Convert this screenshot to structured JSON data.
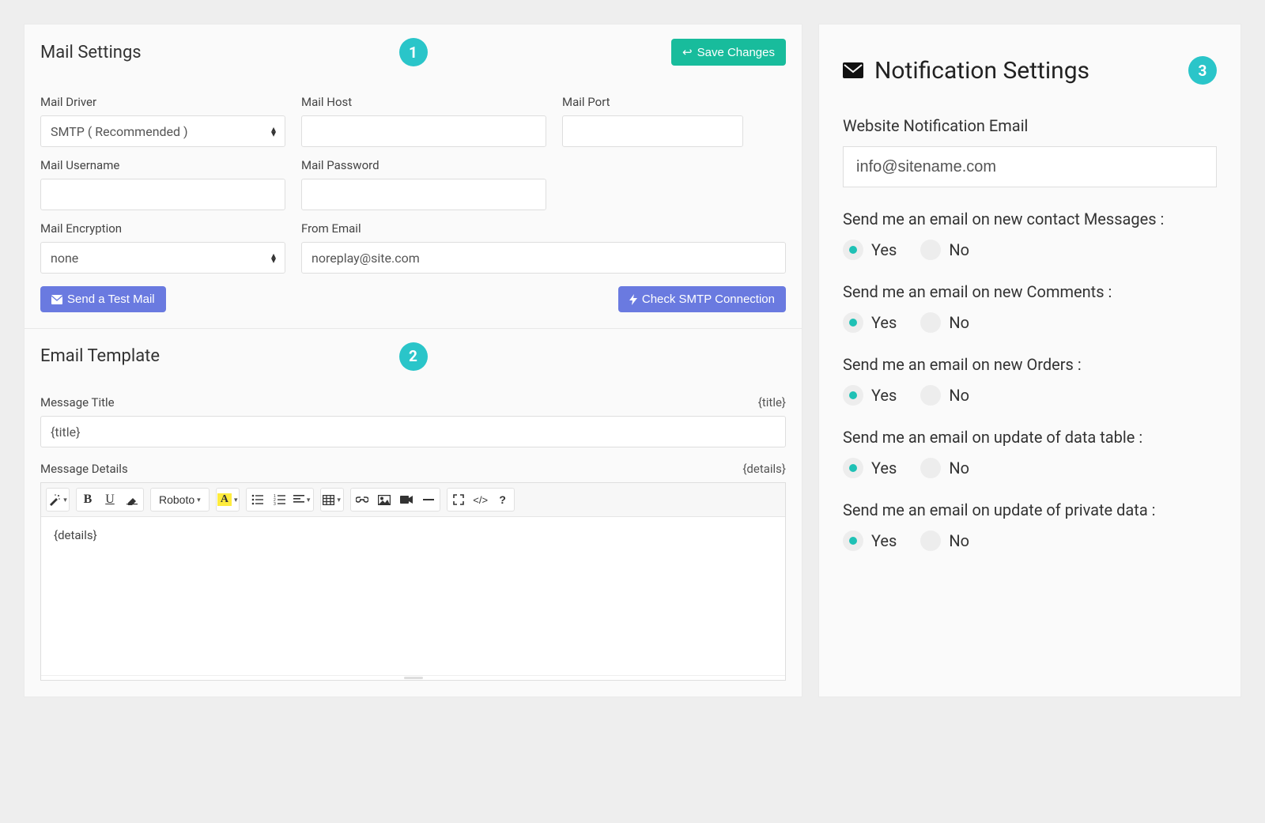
{
  "badges": {
    "one": "1",
    "two": "2",
    "three": "3"
  },
  "mail": {
    "title": "Mail Settings",
    "save_label": "Save Changes",
    "fields": {
      "driver_label": "Mail Driver",
      "driver_value": "SMTP ( Recommended )",
      "host_label": "Mail Host",
      "host_value": "",
      "port_label": "Mail Port",
      "port_value": "",
      "username_label": "Mail Username",
      "username_value": "",
      "password_label": "Mail Password",
      "password_value": "",
      "encryption_label": "Mail Encryption",
      "encryption_value": "none",
      "from_label": "From Email",
      "from_value": "noreplay@site.com"
    },
    "test_mail_label": "Send a Test Mail",
    "check_smtp_label": "Check SMTP Connection"
  },
  "template": {
    "title": "Email Template",
    "msg_title_label": "Message Title",
    "msg_title_hint": "{title}",
    "msg_title_value": "{title}",
    "msg_details_label": "Message Details",
    "msg_details_hint": "{details}",
    "msg_details_value": "{details}",
    "font_name": "Roboto"
  },
  "notif": {
    "title": "Notification Settings",
    "email_label": "Website Notification Email",
    "email_value": "info@sitename.com",
    "yes": "Yes",
    "no": "No",
    "q_contact": "Send me an email on new contact Messages :",
    "q_comments": "Send me an email on new Comments :",
    "q_orders": "Send me an email on new Orders :",
    "q_data_table": "Send me an email on update of data table :",
    "q_private": "Send me an email on update of private data :"
  }
}
